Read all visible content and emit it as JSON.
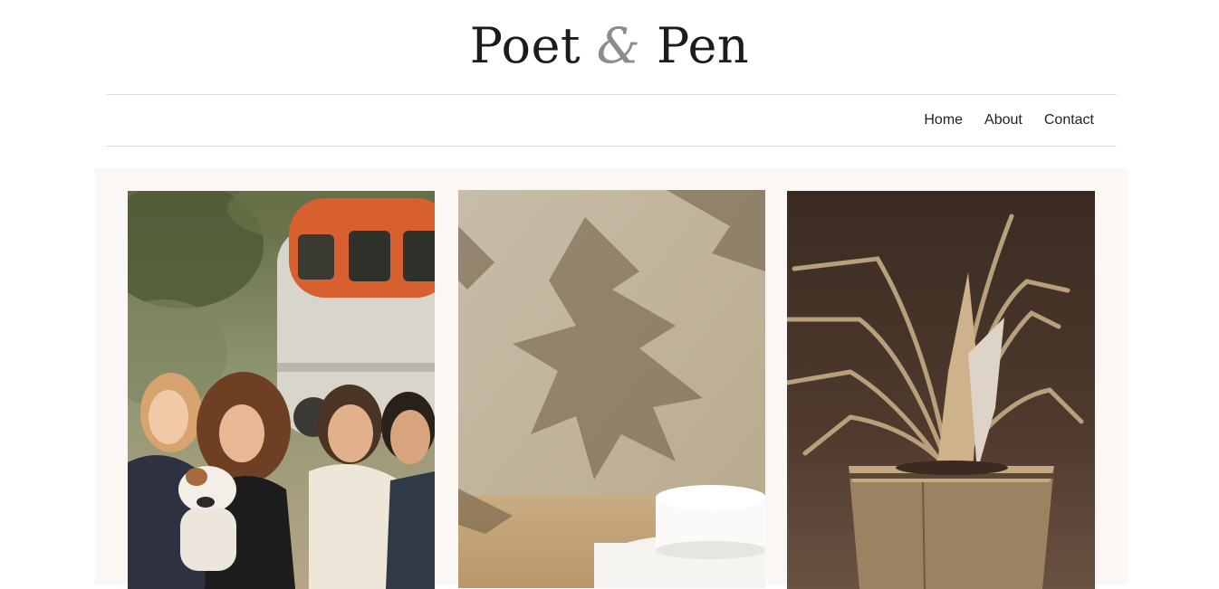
{
  "header": {
    "logo": {
      "word1": "Poet",
      "amp": "&",
      "word2": "Pen"
    }
  },
  "nav": {
    "items": [
      {
        "label": "Home"
      },
      {
        "label": "About"
      },
      {
        "label": "Contact"
      }
    ]
  },
  "gallery": {
    "background": "#fbf7f4",
    "photos": [
      {
        "subject": "friends-with-dog-photo"
      },
      {
        "subject": "leaf-shadow-pedestal-photo"
      },
      {
        "subject": "cardboard-plant-photo"
      }
    ]
  }
}
